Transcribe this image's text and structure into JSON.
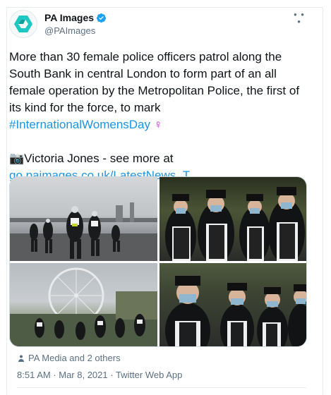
{
  "account": {
    "display_name": "PA Images",
    "handle": "@PAImages",
    "verified": true,
    "avatar_icon": "pa-logo-icon"
  },
  "tweet": {
    "body": "More than 30 female police officers patrol along the South Bank in central London to form part of an all female operation by the Metropolitan Police, the first of its kind for the force, to mark",
    "hashtag": "#InternationalWomensDay",
    "emoji": "♀",
    "credit_emoji": "📷",
    "credit": "Victoria Jones - see more at",
    "link": "go.paimages.co.uk/LatestNews_T"
  },
  "media": {
    "count": 4,
    "tagged": "PA Media and 2 others"
  },
  "meta": {
    "timestamp": "8:51 AM · Mar 8, 2021 · Twitter Web App"
  },
  "colors": {
    "link": "#1b95e0",
    "muted": "#5b7083",
    "verified": "#1da1f2",
    "pa_logo": "#1ec8c2"
  }
}
